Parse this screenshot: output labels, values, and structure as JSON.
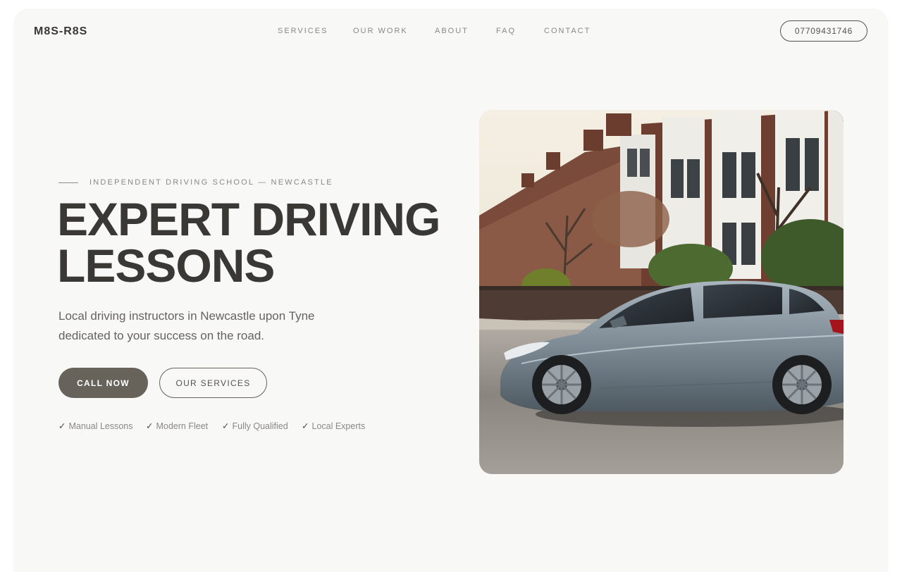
{
  "brand": {
    "logo": "M8S-R8S"
  },
  "nav": {
    "links": [
      "SERVICES",
      "OUR WORK",
      "ABOUT",
      "FAQ",
      "CONTACT"
    ],
    "phone": "07709431746"
  },
  "hero": {
    "eyebrow": "INDEPENDENT DRIVING SCHOOL — NEWCASTLE",
    "headline_line1": "EXPERT DRIVING",
    "headline_line2": "LESSONS",
    "lede": "Local driving instructors in Newcastle upon Tyne dedicated to your success on the road.",
    "cta_primary": "CALL NOW",
    "cta_secondary": "OUR SERVICES",
    "features": [
      "Manual Lessons",
      "Modern Fleet",
      "Fully Qualified",
      "Local Experts"
    ],
    "check_glyph": "✓",
    "image": "grey hatchback car parked on a residential street with terraced houses"
  },
  "colors": {
    "page_bg": "#f8f8f6",
    "text_dark": "#3a3835",
    "text_muted": "#8a8884",
    "button_fill": "#67625a"
  }
}
